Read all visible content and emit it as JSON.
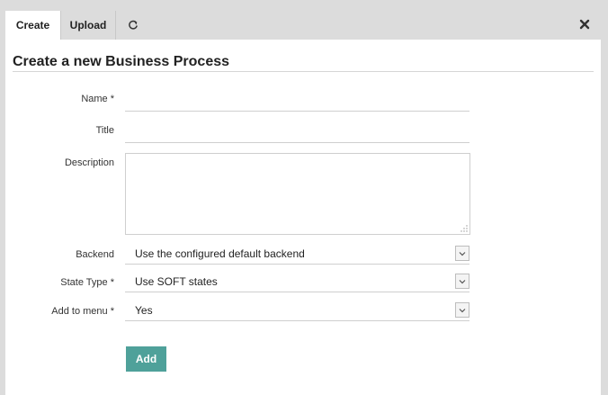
{
  "tabs": [
    {
      "label": "Create",
      "active": true
    },
    {
      "label": "Upload",
      "active": false
    }
  ],
  "icons": {
    "refresh": "refresh-icon",
    "close": "close-icon",
    "chevron": "chevron-down-icon"
  },
  "form": {
    "title": "Create a new Business Process",
    "name_label": "Name *",
    "name_value": "",
    "title_label": "Title",
    "title_value": "",
    "description_label": "Description",
    "description_value": "",
    "backend_label": "Backend",
    "backend_value": "Use the configured default backend",
    "state_type_label": "State Type *",
    "state_type_value": "Use SOFT states",
    "add_to_menu_label": "Add to menu *",
    "add_to_menu_value": "Yes",
    "submit_label": "Add"
  },
  "colors": {
    "accent": "#4fa19a",
    "tabbar": "#dcdcdc"
  }
}
